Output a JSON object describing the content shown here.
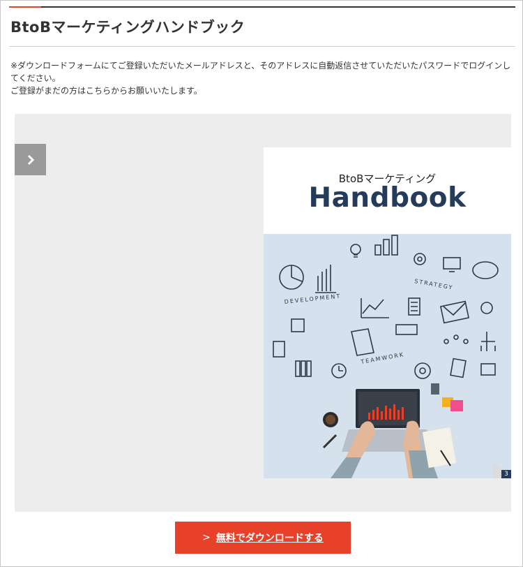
{
  "header": {
    "title": "BtoBマーケティングハンドブック"
  },
  "notice": {
    "line1": "※ダウンロードフォームにてご登録いただいたメールアドレスと、そのアドレスに自動返信させていただいたパスワードでログインしてください。",
    "line2": "ご登録がまだの方はこちらからお願いいたします。"
  },
  "viewer": {
    "next_icon": "chevron-right-icon",
    "page": {
      "subtitle": "BtoBマーケティング",
      "brand": "Handbook",
      "page_number": "3"
    }
  },
  "download": {
    "arrow": ">",
    "label": "無料でダウンロードする"
  },
  "colors": {
    "accent": "#e8412a",
    "brand_navy": "#243b59",
    "viewer_bg": "#ededed",
    "illustration_bg": "#d5e1ec"
  }
}
